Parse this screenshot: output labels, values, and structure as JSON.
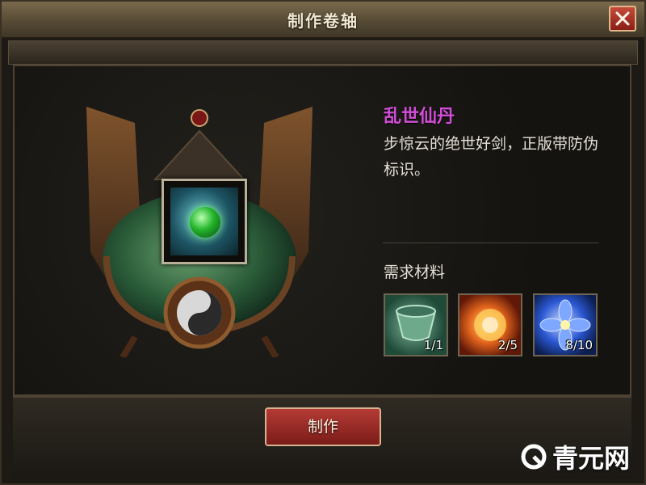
{
  "window": {
    "title": "制作卷轴"
  },
  "item": {
    "name": "乱世仙丹",
    "description": "步惊云的绝世好剑，正版带防伪标识。"
  },
  "materials": {
    "title": "需求材料",
    "items": [
      {
        "icon": "jade-cup-icon",
        "count": "1/1"
      },
      {
        "icon": "fire-orb-icon",
        "count": "2/5"
      },
      {
        "icon": "blue-flower-icon",
        "count": "8/10"
      }
    ]
  },
  "action": {
    "make_label": "制作"
  },
  "watermark": {
    "text": "青元网"
  },
  "colors": {
    "item_name": "#d24ed8",
    "panel_bg": "#1d1a15",
    "button_red": "#b53a35"
  }
}
